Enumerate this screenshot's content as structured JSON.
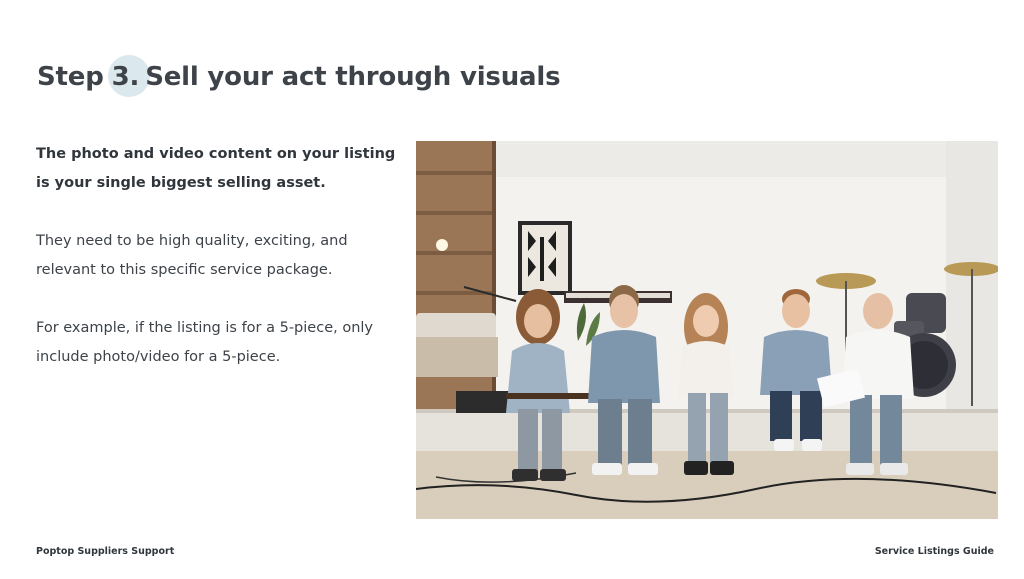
{
  "header": {
    "step_word": "Step",
    "step_number": "3.",
    "title": "Sell your act through visuals",
    "accent_color": "#dbe8ee"
  },
  "content": {
    "lead": "The photo and video content on your listing is your single biggest selling asset.",
    "paragraph_1": "They need to be high quality, exciting, and relevant to this specific service package.",
    "paragraph_2": "For example, if the listing is for a 5-piece, only include photo/video for a 5-piece."
  },
  "footer": {
    "left": "Poptop Suppliers Support",
    "right": "Service Listings Guide"
  }
}
